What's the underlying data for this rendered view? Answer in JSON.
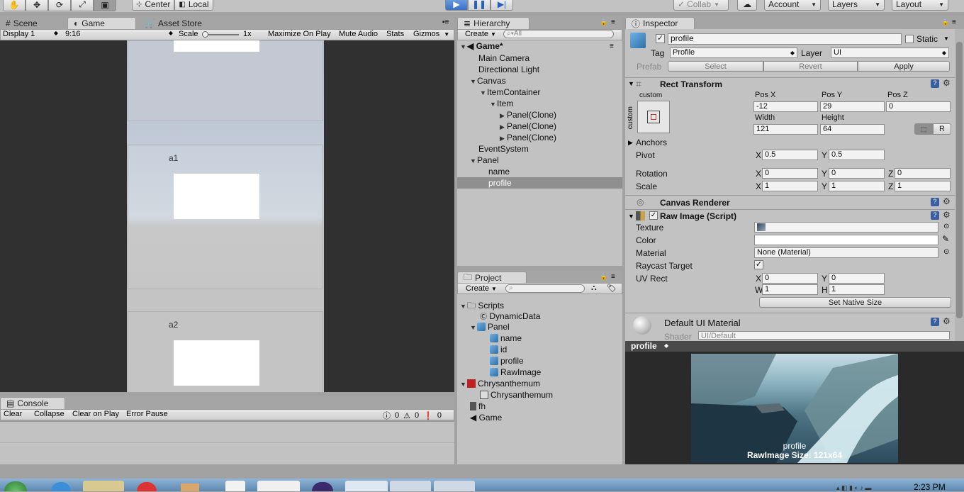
{
  "toolbar": {
    "center_label": "Center",
    "local_label": "Local",
    "collab_label": "Collab",
    "account_label": "Account",
    "layers_label": "Layers",
    "layout_label": "Layout"
  },
  "scene_tabs": {
    "scene": "Scene",
    "game": "Game",
    "asset_store": "Asset Store"
  },
  "game_bar": {
    "display": "Display 1",
    "aspect": "9:16",
    "scale_label": "Scale",
    "scale_value": "1x",
    "maximize": "Maximize On Play",
    "mute": "Mute Audio",
    "stats": "Stats",
    "gizmos": "Gizmos"
  },
  "game_view": {
    "items": [
      "a1",
      "a2"
    ]
  },
  "console": {
    "tab": "Console",
    "clear": "Clear",
    "collapse": "Collapse",
    "clear_on_play": "Clear on Play",
    "error_pause": "Error Pause",
    "log_count": "0",
    "warn_count": "0",
    "error_count": "0"
  },
  "hierarchy": {
    "tab": "Hierarchy",
    "create": "Create",
    "search_placeholder": "All",
    "scene_name": "Game*",
    "items": [
      {
        "label": "Main Camera"
      },
      {
        "label": "Directional Light"
      },
      {
        "label": "Canvas"
      },
      {
        "label": "ItemContainer"
      },
      {
        "label": "Item"
      },
      {
        "label": "Panel(Clone)"
      },
      {
        "label": "Panel(Clone)"
      },
      {
        "label": "Panel(Clone)"
      },
      {
        "label": "EventSystem"
      },
      {
        "label": "Panel"
      },
      {
        "label": "name"
      },
      {
        "label": "profile"
      }
    ]
  },
  "project": {
    "tab": "Project",
    "create": "Create",
    "items": [
      {
        "label": "Scripts"
      },
      {
        "label": "DynamicData"
      },
      {
        "label": "Panel"
      },
      {
        "label": "name"
      },
      {
        "label": "id"
      },
      {
        "label": "profile"
      },
      {
        "label": "RawImage"
      },
      {
        "label": "Chrysanthemum"
      },
      {
        "label": "Chrysanthemum"
      },
      {
        "label": "fh"
      },
      {
        "label": "Game"
      }
    ]
  },
  "inspector": {
    "tab": "Inspector",
    "object_name": "profile",
    "static_label": "Static",
    "tag_label": "Tag",
    "tag_value": "Profile",
    "layer_label": "Layer",
    "layer_value": "UI",
    "prefab_label": "Prefab",
    "select": "Select",
    "revert": "Revert",
    "apply": "Apply",
    "rect_transform": "Rect Transform",
    "anchor_preset": "custom",
    "anchor_side": "custom",
    "pos_x_label": "Pos X",
    "pos_y_label": "Pos Y",
    "pos_z_label": "Pos Z",
    "pos_x": "-12",
    "pos_y": "29",
    "pos_z": "0",
    "width_label": "Width",
    "height_label": "Height",
    "width": "121",
    "height": "64",
    "r_button": "R",
    "anchors": "Anchors",
    "pivot_label": "Pivot",
    "pivot_x": "0.5",
    "pivot_y": "0.5",
    "rotation_label": "Rotation",
    "rot_x": "0",
    "rot_y": "0",
    "rot_z": "0",
    "scale_label": "Scale",
    "scale_x": "1",
    "scale_y": "1",
    "scale_z": "1",
    "canvas_renderer": "Canvas Renderer",
    "raw_image": "Raw Image (Script)",
    "texture_label": "Texture",
    "color_label": "Color",
    "material_label": "Material",
    "material_value": "None (Material)",
    "raycast_label": "Raycast Target",
    "uvrect_label": "UV Rect",
    "uv_x": "0",
    "uv_y": "0",
    "uv_w": "1",
    "uv_h": "1",
    "set_native": "Set Native Size",
    "default_material": "Default UI Material",
    "shader_label": "Shader",
    "shader_value": "UI/Default",
    "x": "X",
    "y": "Y",
    "z": "Z",
    "w": "W",
    "h": "H"
  },
  "preview": {
    "title": "profile",
    "caption_name": "profile",
    "caption_size": "RawImage Size: 121x64"
  },
  "taskbar": {
    "clock": "2:23 PM"
  }
}
